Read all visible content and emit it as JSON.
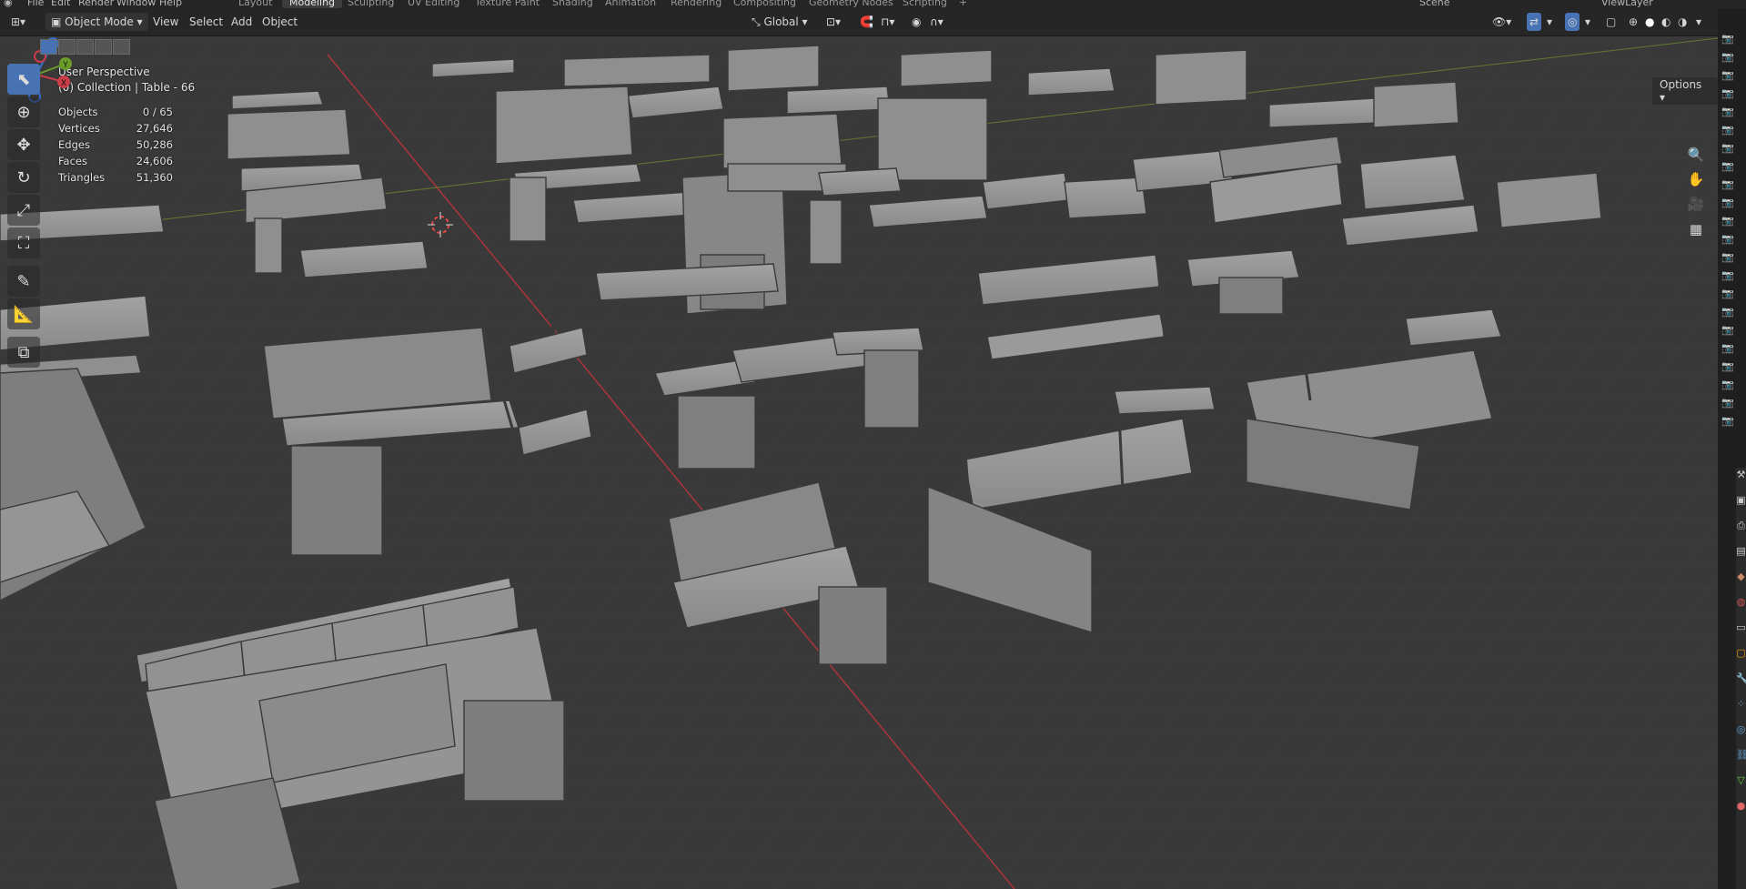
{
  "menubar": {
    "items": [
      "File",
      "Edit",
      "Render",
      "Window",
      "Help"
    ],
    "workspaces": [
      "Layout",
      "Modeling",
      "Sculpting",
      "UV Editing",
      "Texture Paint",
      "Shading",
      "Animation",
      "Rendering",
      "Compositing",
      "Geometry Nodes",
      "Scripting"
    ],
    "active_workspace": "Modeling",
    "add_tab": "+",
    "scene_label": "Scene",
    "viewlayer_label": "ViewLayer"
  },
  "header": {
    "mode": "Object Mode",
    "menus": [
      "View",
      "Select",
      "Add",
      "Object"
    ],
    "orientation": "Global",
    "options_label": "Options"
  },
  "viewport": {
    "perspective_label": "User Perspective",
    "collection_label": "(0) Collection | Table - 66",
    "stats": [
      {
        "label": "Objects",
        "value": "0 / 65"
      },
      {
        "label": "Vertices",
        "value": "27,646"
      },
      {
        "label": "Edges",
        "value": "50,286"
      },
      {
        "label": "Faces",
        "value": "24,606"
      },
      {
        "label": "Triangles",
        "value": "51,360"
      }
    ]
  },
  "gizmo": {
    "x": "X",
    "y": "Y",
    "z": "Z"
  },
  "colors": {
    "accent": "#4772b3",
    "x_axis": "#c93c48",
    "y_axis": "#6a9c2a",
    "z_axis": "#2f6fd0",
    "grid": "#444444",
    "mesh": "#8e8e8e"
  },
  "icons": {
    "select": "cursor-select-icon",
    "cursor": "3d-cursor-icon",
    "move": "move-icon",
    "rotate": "rotate-icon",
    "scale": "scale-icon",
    "transform": "transform-icon",
    "annotate": "annotate-icon",
    "measure": "measure-icon",
    "add_cube": "add-cube-icon",
    "zoom": "zoom-icon",
    "pan": "hand-icon",
    "camera": "camera-icon",
    "ortho": "grid-icon"
  }
}
